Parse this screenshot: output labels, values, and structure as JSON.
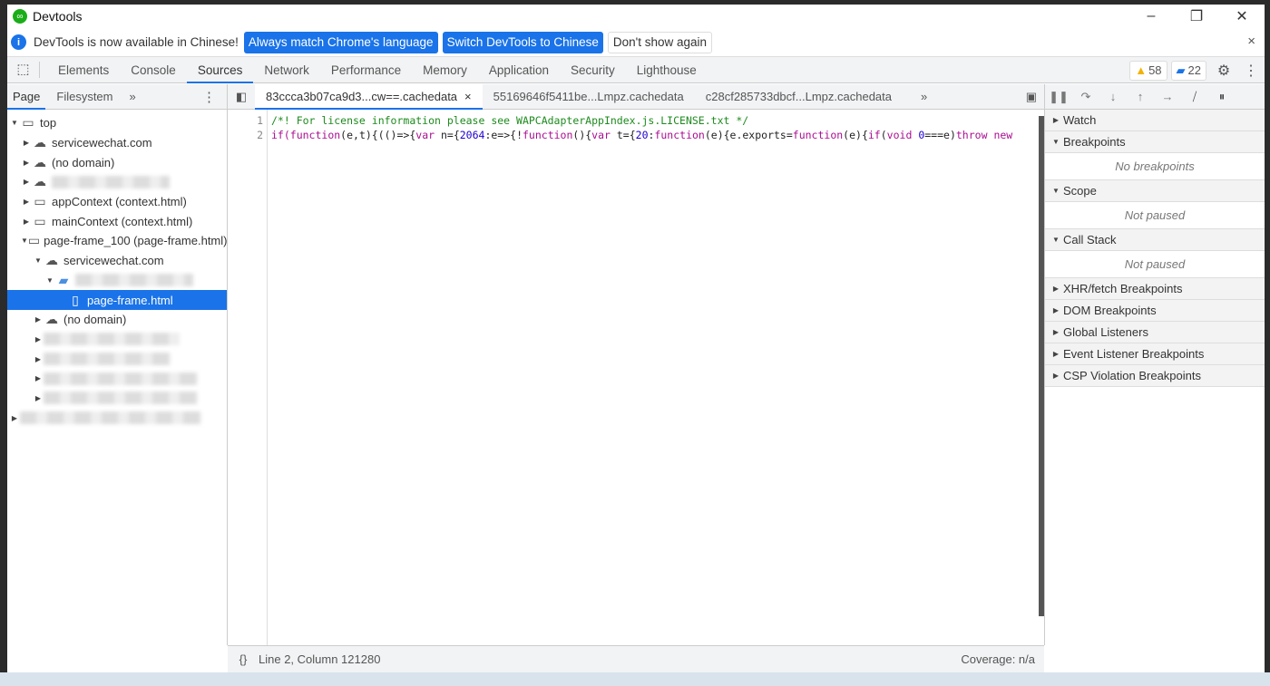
{
  "window": {
    "title": "Devtools",
    "minimize": "–",
    "restore": "❐",
    "close": "✕"
  },
  "infobar": {
    "message": "DevTools is now available in Chinese!",
    "buttons": [
      "Always match Chrome's language",
      "Switch DevTools to Chinese",
      "Don't show again"
    ],
    "close": "×"
  },
  "panel_tabs": [
    "Elements",
    "Console",
    "Sources",
    "Network",
    "Performance",
    "Memory",
    "Application",
    "Security",
    "Lighthouse"
  ],
  "active_panel": "Sources",
  "badges": {
    "warnings": "58",
    "messages": "22"
  },
  "navigator": {
    "tabs": [
      "Page",
      "Filesystem"
    ],
    "more": "»",
    "tree": [
      {
        "label": "top",
        "expanded": true
      },
      {
        "label": "servicewechat.com"
      },
      {
        "label": "(no domain)"
      },
      {
        "label": ""
      },
      {
        "label": "appContext (context.html)"
      },
      {
        "label": "mainContext (context.html)"
      },
      {
        "label": "page-frame_100 (page-frame.html)"
      },
      {
        "label": "servicewechat.com"
      },
      {
        "label": ""
      },
      {
        "label": "page-frame.html",
        "selected": true
      },
      {
        "label": "(no domain)"
      }
    ]
  },
  "editor": {
    "tabs": [
      "83ccca3b07ca9d3...cw==.cachedata",
      "55169646f5411be...Lmpz.cachedata",
      "c28cf285733dbcf...Lmpz.cachedata"
    ],
    "tab_close": "×",
    "more": "»",
    "line_numbers": [
      "1",
      "2"
    ],
    "lines": [
      [
        {
          "t": "/*! For license information please see WAPCAdapterAppIndex.js.LICENSE.txt */",
          "c": "comment"
        }
      ],
      [
        {
          "t": "if(",
          "c": "keyword"
        },
        {
          "t": "function",
          "c": "keyword"
        },
        {
          "t": "(e,t){(()=>{",
          "c": "plain"
        },
        {
          "t": "var",
          "c": "keyword"
        },
        {
          "t": " n={",
          "c": "plain"
        },
        {
          "t": "2064",
          "c": "number"
        },
        {
          "t": ":e=>{!",
          "c": "plain"
        },
        {
          "t": "function",
          "c": "keyword"
        },
        {
          "t": "(){",
          "c": "plain"
        },
        {
          "t": "var",
          "c": "keyword"
        },
        {
          "t": " t={",
          "c": "plain"
        },
        {
          "t": "20",
          "c": "number"
        },
        {
          "t": ":",
          "c": "plain"
        },
        {
          "t": "function",
          "c": "keyword"
        },
        {
          "t": "(e){e.exports=",
          "c": "plain"
        },
        {
          "t": "function",
          "c": "keyword"
        },
        {
          "t": "(e){",
          "c": "plain"
        },
        {
          "t": "if",
          "c": "keyword"
        },
        {
          "t": "(",
          "c": "plain"
        },
        {
          "t": "void",
          "c": "keyword"
        },
        {
          "t": " ",
          "c": "plain"
        },
        {
          "t": "0",
          "c": "number"
        },
        {
          "t": "===e)",
          "c": "plain"
        },
        {
          "t": "throw",
          "c": "keyword"
        },
        {
          "t": " ",
          "c": "plain"
        },
        {
          "t": "new",
          "c": "keyword"
        }
      ]
    ]
  },
  "status": {
    "format": "{}",
    "position": "Line 2, Column 121280",
    "coverage": "Coverage: n/a"
  },
  "debugger": {
    "sections": [
      {
        "label": "Watch",
        "expanded": false
      },
      {
        "label": "Breakpoints",
        "expanded": true,
        "empty": "No breakpoints"
      },
      {
        "label": "Scope",
        "expanded": true,
        "empty": "Not paused"
      },
      {
        "label": "Call Stack",
        "expanded": true,
        "empty": "Not paused"
      },
      {
        "label": "XHR/fetch Breakpoints",
        "expanded": false
      },
      {
        "label": "DOM Breakpoints",
        "expanded": false
      },
      {
        "label": "Global Listeners",
        "expanded": false
      },
      {
        "label": "Event Listener Breakpoints",
        "expanded": false
      },
      {
        "label": "CSP Violation Breakpoints",
        "expanded": false
      }
    ]
  }
}
